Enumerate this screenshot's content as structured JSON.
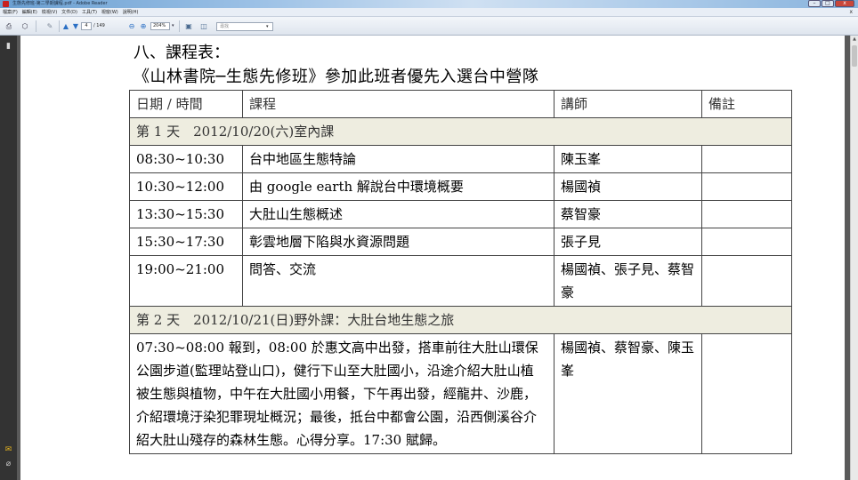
{
  "window": {
    "title": "生態先修班-第二學期課程.pdf - Adobe Reader",
    "controls": [
      "–",
      "□",
      "x"
    ]
  },
  "menu": {
    "items": [
      "檔案(F)",
      "編輯(E)",
      "檢視(V)",
      "文件(D)",
      "工具(T)",
      "視窗(W)",
      "說明(H)"
    ],
    "close": "x"
  },
  "toolbar": {
    "page_current": "4",
    "page_total": "/ 149",
    "zoom": "204%",
    "find_placeholder": "尋找"
  },
  "document": {
    "section_title": "八、課程表：",
    "course_title": "《山林書院─生態先修班》參加此班者優先入選台中營隊",
    "headers": [
      "日期 / 時間",
      "課程",
      "講師",
      "備註"
    ],
    "days": [
      {
        "label": "第 1 天　2012/10/20(六)室內課",
        "rows": [
          {
            "time": "08:30~10:30",
            "course": "台中地區生態特論",
            "lecturer": "陳玉峯",
            "note": ""
          },
          {
            "time": "10:30~12:00",
            "course": "由 google earth 解說台中環境概要",
            "lecturer": "楊國禎",
            "note": ""
          },
          {
            "time": "13:30~15:30",
            "course": "大肚山生態概述",
            "lecturer": "蔡智豪",
            "note": ""
          },
          {
            "time": "15:30~17:30",
            "course": "彰雲地層下陷與水資源問題",
            "lecturer": "張子見",
            "note": ""
          },
          {
            "time": "19:00~21:00",
            "course": "問答、交流",
            "lecturer": "楊國禎、張子見、蔡智豪",
            "note": ""
          }
        ]
      },
      {
        "label": "第 2 天　2012/10/21(日)野外課：大肚台地生態之旅",
        "rows": [
          {
            "text": "07:30~08:00 報到，08:00 於惠文高中出發，搭車前往大肚山環保公園步道(監理站登山口)，健行下山至大肚國小，沿途介紹大肚山植被生態與植物，中午在大肚國小用餐，下午再出發，經龍井、沙鹿，介紹環境汙染犯罪現址概況；最後，抵台中都會公園，沿西側溪谷介紹大肚山殘存的森林生態。心得分享。17:30 賦歸。",
            "lecturer": "楊國禎、蔡智豪、陳玉峯",
            "note": ""
          }
        ]
      }
    ]
  }
}
